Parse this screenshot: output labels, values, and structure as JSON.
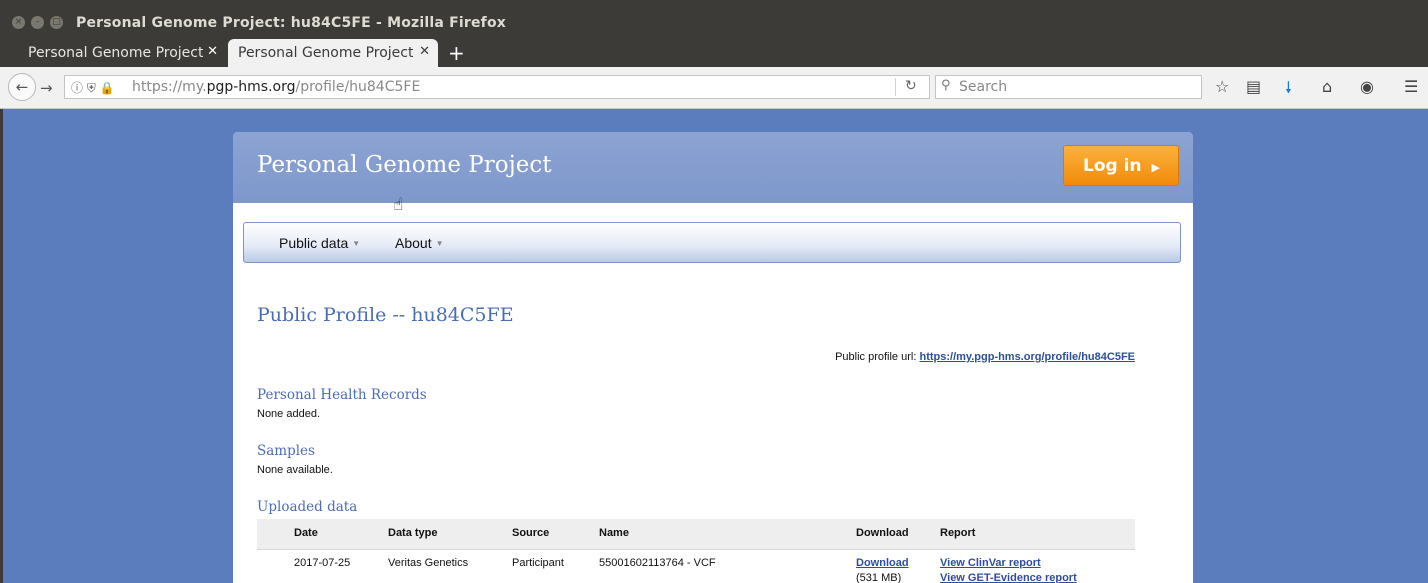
{
  "window": {
    "title": "Personal Genome Project: hu84C5FE - Mozilla Firefox",
    "buttons": {
      "close": "×",
      "minimize": "–",
      "maximize": "□"
    }
  },
  "tabs": [
    {
      "label": "Personal Genome Project",
      "close": "✕"
    },
    {
      "label": "Personal Genome Project",
      "close": "✕"
    }
  ],
  "new_tab": "+",
  "navbar": {
    "url_prefix": "https://my.",
    "url_host": "pgp-hms.org",
    "url_path": "/profile/hu84C5FE",
    "search_placeholder": "Search"
  },
  "site": {
    "title": "Personal Genome Project",
    "login_label": "Log in",
    "menu": [
      {
        "label": "Public data"
      },
      {
        "label": "About"
      }
    ]
  },
  "profile": {
    "heading": "Public Profile -- hu84C5FE",
    "url_label": "Public profile url:",
    "url_link": "https://my.pgp-hms.org/profile/hu84C5FE",
    "health_title": "Personal Health Records",
    "health_text": "None added.",
    "samples_title": "Samples",
    "samples_text": "None available.",
    "uploaded_title": "Uploaded data"
  },
  "table": {
    "headers": [
      "Date",
      "Data type",
      "Source",
      "Name",
      "Download",
      "Report"
    ],
    "rows": [
      {
        "date": "2017-07-25",
        "data_type": "Veritas Genetics",
        "source": "Participant",
        "name": "55001602113764 - VCF",
        "download": "Download",
        "download_size": "(531 MB)",
        "report_1": "View ClinVar report",
        "report_2": "View GET-Evidence report"
      }
    ]
  },
  "colors": {
    "page_background": "#5b7cbd",
    "link": "#2c4f9c",
    "heading": "#4a6db3",
    "login_button": "#f6980f"
  },
  "icons": [
    "back-arrow-icon",
    "forward-arrow-icon",
    "info-icon",
    "shield-icon",
    "lock-icon",
    "reload-icon",
    "search-icon",
    "bookmark-star-icon",
    "reading-list-icon",
    "download-icon",
    "home-icon",
    "pocket-icon",
    "hamburger-menu-icon",
    "pointer-cursor-icon"
  ]
}
